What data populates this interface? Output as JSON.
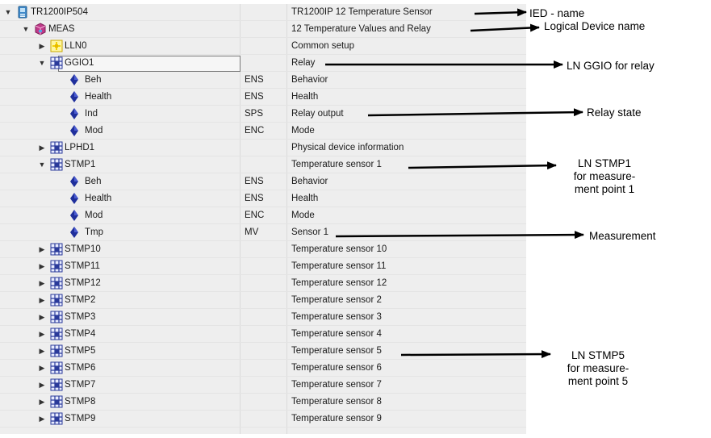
{
  "rows": [
    {
      "depth": 0,
      "exp": "down",
      "icon": "ied-icon",
      "label": "TR1200IP504",
      "type": "",
      "desc": "TR1200IP 12 Temperature Sensor"
    },
    {
      "depth": 1,
      "exp": "down",
      "icon": "logical-device-icon",
      "label": "MEAS",
      "type": "",
      "desc": "12 Temperature Values and Relay"
    },
    {
      "depth": 2,
      "exp": "right",
      "icon": "lln0-icon",
      "label": "LLN0",
      "type": "",
      "desc": "Common setup"
    },
    {
      "depth": 2,
      "exp": "down",
      "icon": "logical-node-icon",
      "label": "GGIO1",
      "type": "",
      "desc": "Relay",
      "selected": true
    },
    {
      "depth": 3,
      "exp": "",
      "icon": "data-object-icon",
      "label": "Beh",
      "type": "ENS",
      "desc": "Behavior"
    },
    {
      "depth": 3,
      "exp": "",
      "icon": "data-object-icon",
      "label": "Health",
      "type": "ENS",
      "desc": "Health"
    },
    {
      "depth": 3,
      "exp": "",
      "icon": "data-object-icon",
      "label": "Ind",
      "type": "SPS",
      "desc": "Relay output"
    },
    {
      "depth": 3,
      "exp": "",
      "icon": "data-object-icon",
      "label": "Mod",
      "type": "ENC",
      "desc": "Mode"
    },
    {
      "depth": 2,
      "exp": "right",
      "icon": "logical-node-icon",
      "label": "LPHD1",
      "type": "",
      "desc": "Physical device information"
    },
    {
      "depth": 2,
      "exp": "down",
      "icon": "logical-node-icon",
      "label": "STMP1",
      "type": "",
      "desc": "Temperature sensor 1"
    },
    {
      "depth": 3,
      "exp": "",
      "icon": "data-object-icon",
      "label": "Beh",
      "type": "ENS",
      "desc": "Behavior"
    },
    {
      "depth": 3,
      "exp": "",
      "icon": "data-object-icon",
      "label": "Health",
      "type": "ENS",
      "desc": "Health"
    },
    {
      "depth": 3,
      "exp": "",
      "icon": "data-object-icon",
      "label": "Mod",
      "type": "ENC",
      "desc": "Mode"
    },
    {
      "depth": 3,
      "exp": "",
      "icon": "data-object-icon",
      "label": "Tmp",
      "type": "MV",
      "desc": "Sensor 1"
    },
    {
      "depth": 2,
      "exp": "right",
      "icon": "logical-node-icon",
      "label": "STMP10",
      "type": "",
      "desc": "Temperature sensor 10"
    },
    {
      "depth": 2,
      "exp": "right",
      "icon": "logical-node-icon",
      "label": "STMP11",
      "type": "",
      "desc": "Temperature sensor 11"
    },
    {
      "depth": 2,
      "exp": "right",
      "icon": "logical-node-icon",
      "label": "STMP12",
      "type": "",
      "desc": "Temperature sensor 12"
    },
    {
      "depth": 2,
      "exp": "right",
      "icon": "logical-node-icon",
      "label": "STMP2",
      "type": "",
      "desc": "Temperature sensor 2"
    },
    {
      "depth": 2,
      "exp": "right",
      "icon": "logical-node-icon",
      "label": "STMP3",
      "type": "",
      "desc": "Temperature sensor 3"
    },
    {
      "depth": 2,
      "exp": "right",
      "icon": "logical-node-icon",
      "label": "STMP4",
      "type": "",
      "desc": "Temperature sensor 4"
    },
    {
      "depth": 2,
      "exp": "right",
      "icon": "logical-node-icon",
      "label": "STMP5",
      "type": "",
      "desc": "Temperature sensor 5"
    },
    {
      "depth": 2,
      "exp": "right",
      "icon": "logical-node-icon",
      "label": "STMP6",
      "type": "",
      "desc": "Temperature sensor 6"
    },
    {
      "depth": 2,
      "exp": "right",
      "icon": "logical-node-icon",
      "label": "STMP7",
      "type": "",
      "desc": "Temperature sensor 7"
    },
    {
      "depth": 2,
      "exp": "right",
      "icon": "logical-node-icon",
      "label": "STMP8",
      "type": "",
      "desc": "Temperature sensor 8"
    },
    {
      "depth": 2,
      "exp": "right",
      "icon": "logical-node-icon",
      "label": "STMP9",
      "type": "",
      "desc": "Temperature sensor 9"
    }
  ],
  "annotations": {
    "ied_name": "IED - name",
    "logical_device_name": "Logical Device name",
    "ln_ggio": "LN GGIO for relay",
    "relay_state": "Relay state",
    "ln_stmp1": [
      "LN STMP1",
      "for measure-",
      "ment point 1"
    ],
    "measurement": "Measurement",
    "ln_stmp5": [
      "LN STMP5",
      "for measure-",
      "ment point 5"
    ]
  },
  "colors": {
    "panel_bg": "#eeeeee",
    "data_object": "#1f2f9c",
    "logical_node": "#2a3a9a",
    "logical_device": "#c03a8a",
    "ied": "#3f89c9",
    "lln0": "#f0d000"
  }
}
